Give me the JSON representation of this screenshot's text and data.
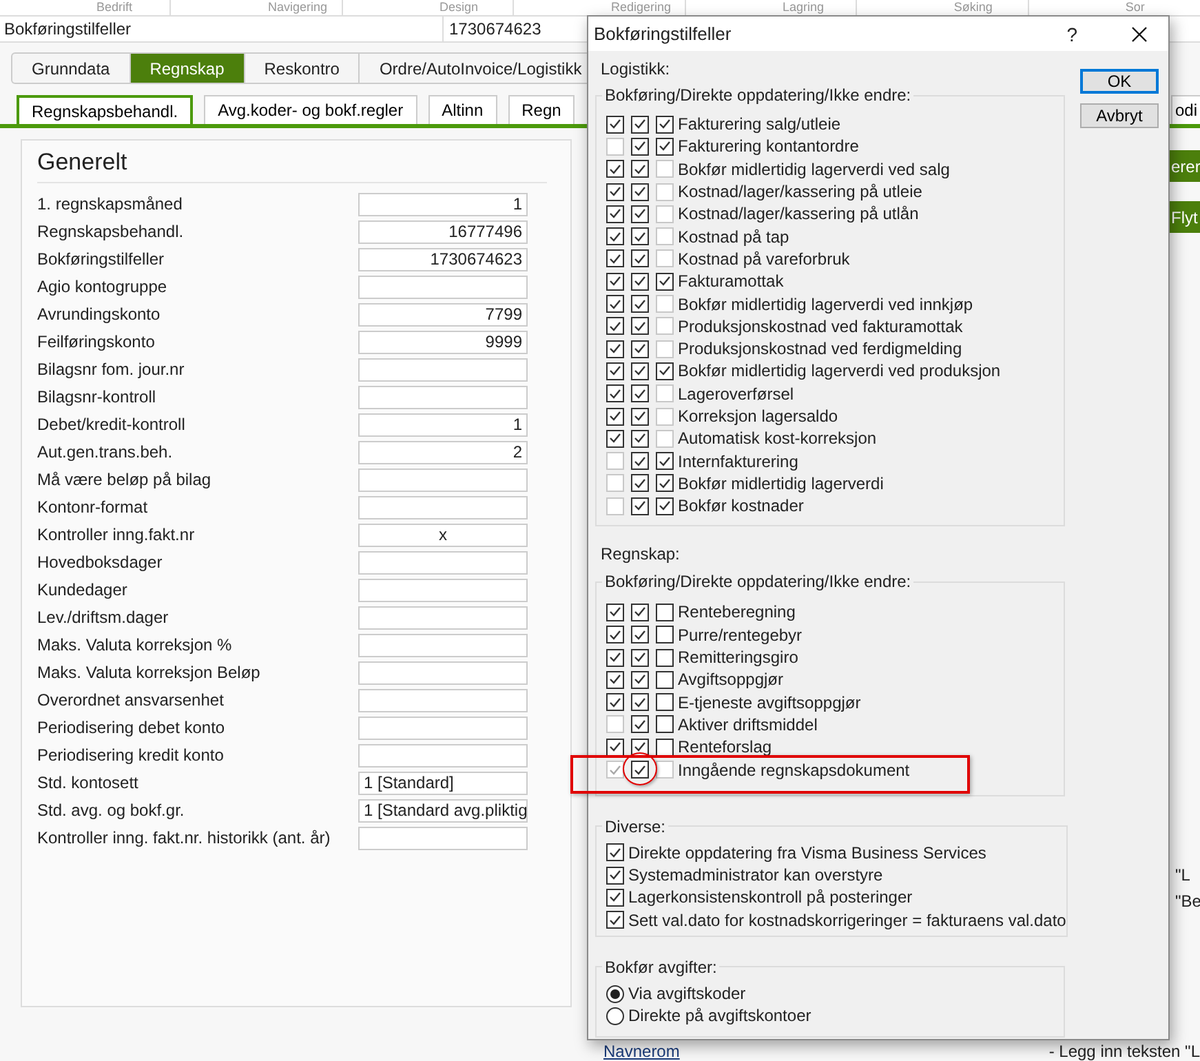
{
  "menu": [
    "Bedrift",
    "Navigering",
    "Design",
    "Redigering",
    "Lagring",
    "Søking",
    "Sor"
  ],
  "record": {
    "name": "Bokføringstilfeller",
    "value": "1730674623"
  },
  "tabs": [
    {
      "label": "Grunndata",
      "selected": false
    },
    {
      "label": "Regnskap",
      "selected": true
    },
    {
      "label": "Reskontro",
      "selected": false
    },
    {
      "label": "Ordre/AutoInvoice/Logistikk",
      "selected": false
    }
  ],
  "subtabs": [
    {
      "label": "Regnskapsbehandl.",
      "selected": true
    },
    {
      "label": "Avg.koder- og bokf.regler",
      "selected": false
    },
    {
      "label": "Altinn",
      "selected": false
    },
    {
      "label": "Regn",
      "selected": false
    },
    {
      "label": "odi",
      "selected": false
    }
  ],
  "general": {
    "title": "Generelt",
    "fields": [
      {
        "label": "1. regnskapsmåned",
        "value": "1",
        "kind": "number"
      },
      {
        "label": "Regnskapsbehandl.",
        "value": "16777496",
        "kind": "number"
      },
      {
        "label": "Bokføringstilfeller",
        "value": "1730674623",
        "kind": "number"
      },
      {
        "label": "Agio kontogruppe",
        "kind": "text"
      },
      {
        "label": "Avrundingskonto",
        "value": "7799",
        "kind": "number"
      },
      {
        "label": "Feilføringskonto",
        "value": "9999",
        "kind": "number"
      },
      {
        "label": "Bilagsnr fom. jour.nr",
        "kind": "text"
      },
      {
        "label": "Bilagsnr-kontroll",
        "kind": "text"
      },
      {
        "label": "Debet/kredit-kontroll",
        "value": "1",
        "kind": "number"
      },
      {
        "label": "Aut.gen.trans.beh.",
        "value": "2",
        "kind": "number"
      },
      {
        "label": "Må være beløp på bilag",
        "kind": "text"
      },
      {
        "label": "Kontonr-format",
        "kind": "text"
      },
      {
        "label": "Kontroller inng.fakt.nr",
        "value": "x",
        "kind": "flag"
      },
      {
        "label": "Hovedboksdager",
        "kind": "text"
      },
      {
        "label": "Kundedager",
        "kind": "text"
      },
      {
        "label": "Lev./driftsm.dager",
        "kind": "text"
      },
      {
        "label": "Maks. Valuta korreksjon %",
        "kind": "text"
      },
      {
        "label": "Maks. Valuta korreksjon Beløp",
        "kind": "text"
      },
      {
        "label": "Overordnet ansvarsenhet",
        "kind": "text"
      },
      {
        "label": "Periodisering debet konto",
        "kind": "text"
      },
      {
        "label": "Periodisering kredit konto",
        "kind": "text"
      },
      {
        "label": "Std. kontosett",
        "value": "1 [Standard]",
        "kind": "text"
      },
      {
        "label": "Std. avg. og bokf.gr.",
        "value": "1 [Standard avg.pliktig",
        "kind": "text"
      },
      {
        "label": "Kontroller inng. fakt.nr. historikk (ant. år)",
        "kind": "text"
      }
    ]
  },
  "side": {
    "buttons": [
      "erer",
      "Flyt"
    ],
    "notes": [
      "\"L",
      "\"Be"
    ],
    "link": "Navnerom",
    "footer_note": "- Legg inn teksten \"L"
  },
  "dialog": {
    "title": "Bokføringstilfeller",
    "help": "?",
    "buttons": [
      {
        "label": "OK",
        "default": true
      },
      {
        "label": "Avbryt",
        "default": false
      }
    ],
    "sections": [
      {
        "label": "Logistikk:",
        "group_title": "Bokføring/Direkte oppdatering/Ikke endre:",
        "rows": [
          {
            "label": "Fakturering salg/utleie",
            "checks": [
              {
                "checked": true,
                "disabled": false
              },
              {
                "checked": true,
                "disabled": false
              },
              {
                "checked": true,
                "disabled": false
              }
            ]
          },
          {
            "label": "Fakturering kontantordre",
            "checks": [
              {
                "checked": false,
                "disabled": true
              },
              {
                "checked": true,
                "disabled": false
              },
              {
                "checked": true,
                "disabled": false
              }
            ]
          },
          {
            "label": "Bokfør midlertidig lagerverdi ved salg",
            "checks": [
              {
                "checked": true,
                "disabled": false
              },
              {
                "checked": true,
                "disabled": false
              },
              {
                "checked": false,
                "disabled": true
              }
            ]
          },
          {
            "label": "Kostnad/lager/kassering på utleie",
            "checks": [
              {
                "checked": true,
                "disabled": false
              },
              {
                "checked": true,
                "disabled": false
              },
              {
                "checked": false,
                "disabled": true
              }
            ]
          },
          {
            "label": "Kostnad/lager/kassering på utlån",
            "checks": [
              {
                "checked": true,
                "disabled": false
              },
              {
                "checked": true,
                "disabled": false
              },
              {
                "checked": false,
                "disabled": true
              }
            ]
          },
          {
            "label": "Kostnad på tap",
            "checks": [
              {
                "checked": true,
                "disabled": false
              },
              {
                "checked": true,
                "disabled": false
              },
              {
                "checked": false,
                "disabled": true
              }
            ]
          },
          {
            "label": "Kostnad på vareforbruk",
            "checks": [
              {
                "checked": true,
                "disabled": false
              },
              {
                "checked": true,
                "disabled": false
              },
              {
                "checked": false,
                "disabled": true
              }
            ]
          },
          {
            "label": "Fakturamottak",
            "checks": [
              {
                "checked": true,
                "disabled": false
              },
              {
                "checked": true,
                "disabled": false
              },
              {
                "checked": true,
                "disabled": false
              }
            ]
          },
          {
            "label": "Bokfør midlertidig lagerverdi ved innkjøp",
            "checks": [
              {
                "checked": true,
                "disabled": false
              },
              {
                "checked": true,
                "disabled": false
              },
              {
                "checked": false,
                "disabled": true
              }
            ]
          },
          {
            "label": "Produksjonskostnad ved fakturamottak",
            "checks": [
              {
                "checked": true,
                "disabled": false
              },
              {
                "checked": true,
                "disabled": false
              },
              {
                "checked": false,
                "disabled": true
              }
            ]
          },
          {
            "label": "Produksjonskostnad ved ferdigmelding",
            "checks": [
              {
                "checked": true,
                "disabled": false
              },
              {
                "checked": true,
                "disabled": false
              },
              {
                "checked": false,
                "disabled": true
              }
            ]
          },
          {
            "label": "Bokfør midlertidig lagerverdi ved produksjon",
            "checks": [
              {
                "checked": true,
                "disabled": false
              },
              {
                "checked": true,
                "disabled": false
              },
              {
                "checked": true,
                "disabled": false
              }
            ]
          },
          {
            "label": "Lageroverførsel",
            "checks": [
              {
                "checked": true,
                "disabled": false
              },
              {
                "checked": true,
                "disabled": false
              },
              {
                "checked": false,
                "disabled": true
              }
            ]
          },
          {
            "label": "Korreksjon lagersaldo",
            "checks": [
              {
                "checked": true,
                "disabled": false
              },
              {
                "checked": true,
                "disabled": false
              },
              {
                "checked": false,
                "disabled": true
              }
            ]
          },
          {
            "label": "Automatisk kost-korreksjon",
            "checks": [
              {
                "checked": true,
                "disabled": false
              },
              {
                "checked": true,
                "disabled": false
              },
              {
                "checked": false,
                "disabled": true
              }
            ]
          },
          {
            "label": "Internfakturering",
            "checks": [
              {
                "checked": false,
                "disabled": true
              },
              {
                "checked": true,
                "disabled": false
              },
              {
                "checked": true,
                "disabled": false
              }
            ]
          },
          {
            "label": "Bokfør midlertidig lagerverdi",
            "checks": [
              {
                "checked": false,
                "disabled": true
              },
              {
                "checked": true,
                "disabled": false
              },
              {
                "checked": true,
                "disabled": false
              }
            ]
          },
          {
            "label": "Bokfør kostnader",
            "checks": [
              {
                "checked": false,
                "disabled": true
              },
              {
                "checked": true,
                "disabled": false
              },
              {
                "checked": true,
                "disabled": false
              }
            ]
          }
        ]
      },
      {
        "label": "Regnskap:",
        "group_title": "Bokføring/Direkte oppdatering/Ikke endre:",
        "rows": [
          {
            "label": "Renteberegning",
            "checks": [
              {
                "checked": true,
                "disabled": false
              },
              {
                "checked": true,
                "disabled": false
              },
              {
                "checked": false,
                "disabled": false
              }
            ]
          },
          {
            "label": "Purre/rentegebyr",
            "checks": [
              {
                "checked": true,
                "disabled": false
              },
              {
                "checked": true,
                "disabled": false
              },
              {
                "checked": false,
                "disabled": false
              }
            ]
          },
          {
            "label": "Remitteringsgiro",
            "checks": [
              {
                "checked": true,
                "disabled": false
              },
              {
                "checked": true,
                "disabled": false
              },
              {
                "checked": false,
                "disabled": false
              }
            ]
          },
          {
            "label": "Avgiftsoppgjør",
            "checks": [
              {
                "checked": true,
                "disabled": false
              },
              {
                "checked": true,
                "disabled": false
              },
              {
                "checked": false,
                "disabled": false
              }
            ]
          },
          {
            "label": "E-tjeneste avgiftsoppgjør",
            "checks": [
              {
                "checked": true,
                "disabled": false
              },
              {
                "checked": true,
                "disabled": false
              },
              {
                "checked": false,
                "disabled": false
              }
            ]
          },
          {
            "label": "Aktiver driftsmiddel",
            "checks": [
              {
                "checked": false,
                "disabled": true
              },
              {
                "checked": true,
                "disabled": false
              },
              {
                "checked": false,
                "disabled": false
              }
            ]
          },
          {
            "label": "Renteforslag",
            "checks": [
              {
                "checked": true,
                "disabled": false
              },
              {
                "checked": true,
                "disabled": false
              },
              {
                "checked": false,
                "disabled": false
              }
            ]
          },
          {
            "label": "Inngående regnskapsdokument",
            "checks": [
              {
                "checked": true,
                "disabled": true
              },
              {
                "checked": true,
                "disabled": false
              },
              {
                "checked": false,
                "disabled": true
              }
            ]
          }
        ]
      }
    ],
    "misc": {
      "title": "Diverse:",
      "items": [
        {
          "label": "Direkte oppdatering fra Visma Business Services",
          "checked": true
        },
        {
          "label": "Systemadministrator kan overstyre",
          "checked": true
        },
        {
          "label": "Lagerkonsistenskontroll på posteringer",
          "checked": true
        },
        {
          "label": "Sett val.dato for kostnadskorrigeringer = fakturaens val.dato",
          "checked": true
        }
      ]
    },
    "fees": {
      "title": "Bokfør avgifter:",
      "options": [
        {
          "label": "Via avgiftskoder",
          "selected": true
        },
        {
          "label": "Direkte på avgiftskontoer",
          "selected": false
        }
      ]
    }
  }
}
